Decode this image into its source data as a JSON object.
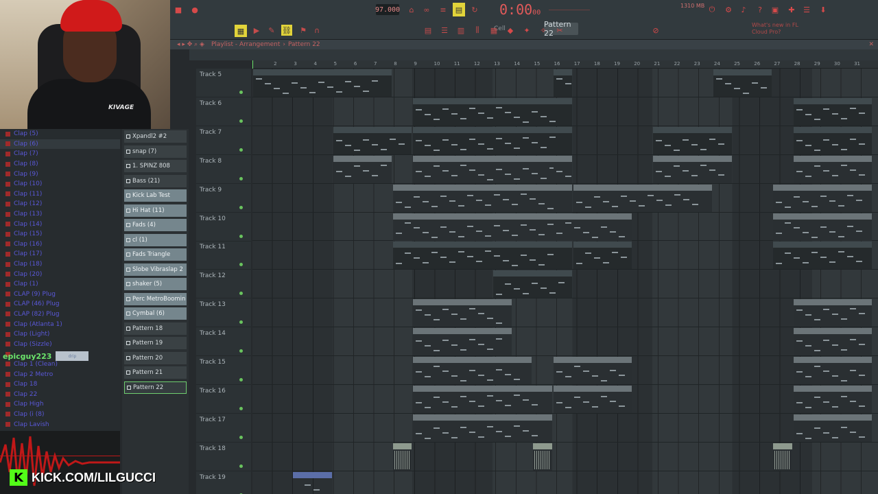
{
  "topbar": {
    "tempo": "97.000",
    "time_main": "0:00",
    "time_sub": "00",
    "pattern": "Pattern 22",
    "cell": "Cell",
    "memory": "1310 MB",
    "news": [
      "What's new in FL",
      "Cloud Pro?"
    ]
  },
  "playlist": {
    "title": "Playlist - Arrangement",
    "pattern": "Pattern 22"
  },
  "ruler": [
    "2",
    "3",
    "4",
    "5",
    "6",
    "7",
    "8",
    "9",
    "10",
    "11",
    "12",
    "13",
    "14",
    "15",
    "16",
    "17",
    "18",
    "19",
    "20",
    "21",
    "22",
    "23",
    "24",
    "25",
    "26",
    "27",
    "28",
    "29",
    "30",
    "31"
  ],
  "browser": [
    "Clap (5)",
    "Clap (6)",
    "Clap (7)",
    "Clap (8)",
    "Clap (9)",
    "Clap (10)",
    "Clap (11)",
    "Clap (12)",
    "Clap (13)",
    "Clap (14)",
    "Clap (15)",
    "Clap (16)",
    "Clap (17)",
    "Clap (18)",
    "Clap (20)",
    "Clap (1)",
    "CLAP (9) Plug",
    "CLAP (46) Plug",
    "CLAP (82) Plug",
    "Clap (Atlanta 1)",
    "Clap (Light)",
    "Clap (Sizzle)",
    "",
    "Clap 1 (Clean)",
    "Clap 2 Metro",
    "Clap 18",
    "Clap 22",
    "Clap High",
    "Clap (i (8)",
    "Clap Lavish"
  ],
  "overlay": {
    "username": "epicguy223",
    "badge": "drip",
    "kick_url": "KICK.COM/LILGUCCI",
    "shirt_logo": "KIVAGE"
  },
  "picker": [
    {
      "label": "Xpandl2 #2",
      "audio": false
    },
    {
      "label": "snap (7)",
      "audio": false
    },
    {
      "label": "1. SPINZ 808",
      "audio": false
    },
    {
      "label": "Bass (21)",
      "audio": false
    },
    {
      "label": "Kick Lab Test",
      "audio": true
    },
    {
      "label": "Hi Hat (11)",
      "audio": true
    },
    {
      "label": "Fads (4)",
      "audio": true
    },
    {
      "label": "cl (1)",
      "audio": true
    },
    {
      "label": "Fads Triangle",
      "audio": true
    },
    {
      "label": "Slobe Vibraslap 2",
      "audio": true
    },
    {
      "label": "shaker (5)",
      "audio": true
    },
    {
      "label": "Perc MetroBoomin",
      "audio": true
    },
    {
      "label": "Cymbal (6)",
      "audio": true
    },
    {
      "label": "Pattern 18",
      "audio": false
    },
    {
      "label": "Pattern 19",
      "audio": false
    },
    {
      "label": "Pattern 20",
      "audio": false
    },
    {
      "label": "Pattern 21",
      "audio": false
    },
    {
      "label": "Pattern 22",
      "audio": false,
      "selected": true
    }
  ],
  "tracks": [
    "Track 5",
    "Track 6",
    "Track 7",
    "Track 8",
    "Track 9",
    "Track 10",
    "Track 11",
    "Track 12",
    "Track 13",
    "Track 14",
    "Track 15",
    "Track 16",
    "Track 17",
    "Track 18",
    "Track 19"
  ],
  "clips": [
    {
      "row": 0,
      "bar": 1,
      "len": 7,
      "label": "Bass (21)",
      "style": "dark"
    },
    {
      "row": 0,
      "bar": 16,
      "len": 1,
      "label": "B...1)",
      "style": "dark"
    },
    {
      "row": 0,
      "bar": 24,
      "len": 3,
      "label": "Bass (21)",
      "style": "dark"
    },
    {
      "row": 1,
      "bar": 9,
      "len": 8,
      "label": "Xpandl2 #2",
      "style": "dark"
    },
    {
      "row": 1,
      "bar": 28,
      "len": 4,
      "label": "Xpandl2 #2",
      "style": "dark"
    },
    {
      "row": 2,
      "bar": 5,
      "len": 4,
      "label": "snap (7)",
      "style": "dark"
    },
    {
      "row": 2,
      "bar": 9,
      "len": 8,
      "label": "snap (7)",
      "style": "dark"
    },
    {
      "row": 2,
      "bar": 21,
      "len": 4,
      "label": "snap (7)",
      "style": "dark"
    },
    {
      "row": 2,
      "bar": 28,
      "len": 4,
      "label": "snap (7)",
      "style": "dark"
    },
    {
      "row": 3,
      "bar": 5,
      "len": 3,
      "label": "Hi Hat (11)",
      "style": "std"
    },
    {
      "row": 3,
      "bar": 9,
      "len": 8,
      "label": "Hi Hat (11)",
      "style": "std"
    },
    {
      "row": 3,
      "bar": 16,
      "len": 1,
      "label": "Hi...1)",
      "style": "std"
    },
    {
      "row": 3,
      "bar": 21,
      "len": 4,
      "label": "Hi Hat (11)",
      "style": "std"
    },
    {
      "row": 3,
      "bar": 28,
      "len": 4,
      "label": "Hi Hat (11)",
      "style": "std"
    },
    {
      "row": 4,
      "bar": 8,
      "len": 9,
      "label": "Kick Lab Test",
      "style": "std"
    },
    {
      "row": 4,
      "bar": 17,
      "len": 7,
      "label": "Kick Lab Test",
      "style": "std"
    },
    {
      "row": 4,
      "bar": 27,
      "len": 5,
      "label": "Kick Lab Test",
      "style": "std"
    },
    {
      "row": 5,
      "bar": 8,
      "len": 9,
      "label": "Cymbal (6)",
      "style": "std"
    },
    {
      "row": 5,
      "bar": 16,
      "len": 4,
      "label": "Cymbal (6)",
      "style": "std"
    },
    {
      "row": 5,
      "bar": 27,
      "len": 5,
      "label": "Cymbal (6)",
      "style": "std"
    },
    {
      "row": 6,
      "bar": 8,
      "len": 9,
      "label": "1. SPINZ 808",
      "style": "dark"
    },
    {
      "row": 6,
      "bar": 17,
      "len": 3,
      "label": "1. SPINZ 808",
      "style": "dark"
    },
    {
      "row": 6,
      "bar": 27,
      "len": 5,
      "label": "1. SPINZ 808",
      "style": "dark"
    },
    {
      "row": 7,
      "bar": 13,
      "len": 4,
      "label": "Pattern 22",
      "style": "dark"
    },
    {
      "row": 8,
      "bar": 9,
      "len": 5,
      "label": "Fads (4)",
      "style": "std"
    },
    {
      "row": 8,
      "bar": 28,
      "len": 4,
      "label": "Fads (4)",
      "style": "std"
    },
    {
      "row": 9,
      "bar": 9,
      "len": 5,
      "label": "cl (1)",
      "style": "std"
    },
    {
      "row": 9,
      "bar": 28,
      "len": 4,
      "label": "cl (1)",
      "style": "std"
    },
    {
      "row": 10,
      "bar": 9,
      "len": 6,
      "label": "Fads Triangle",
      "style": "std"
    },
    {
      "row": 10,
      "bar": 16,
      "len": 4,
      "label": "Fads Triangle",
      "style": "std"
    },
    {
      "row": 10,
      "bar": 28,
      "len": 4,
      "label": "Fads Triangle",
      "style": "std"
    },
    {
      "row": 11,
      "bar": 9,
      "len": 7,
      "label": "Slobe Vibraslap 2",
      "style": "std"
    },
    {
      "row": 11,
      "bar": 16,
      "len": 4,
      "label": "Slobe Vibraslap 2",
      "style": "std"
    },
    {
      "row": 11,
      "bar": 28,
      "len": 4,
      "label": "Slobe Vibraslap 2",
      "style": "std"
    },
    {
      "row": 12,
      "bar": 9,
      "len": 7,
      "label": "shaker (5)",
      "style": "std"
    },
    {
      "row": 12,
      "bar": 28,
      "len": 4,
      "label": "shaker (5)",
      "style": "std"
    },
    {
      "row": 13,
      "bar": 8,
      "len": 1,
      "label": "",
      "style": "audio"
    },
    {
      "row": 13,
      "bar": 15,
      "len": 1,
      "label": "P... ER",
      "style": "audio"
    },
    {
      "row": 13,
      "bar": 27,
      "len": 1,
      "label": "",
      "style": "audio"
    },
    {
      "row": 14,
      "bar": 3,
      "len": 2,
      "label": "Tag Wit Riser",
      "style": "blue"
    }
  ]
}
